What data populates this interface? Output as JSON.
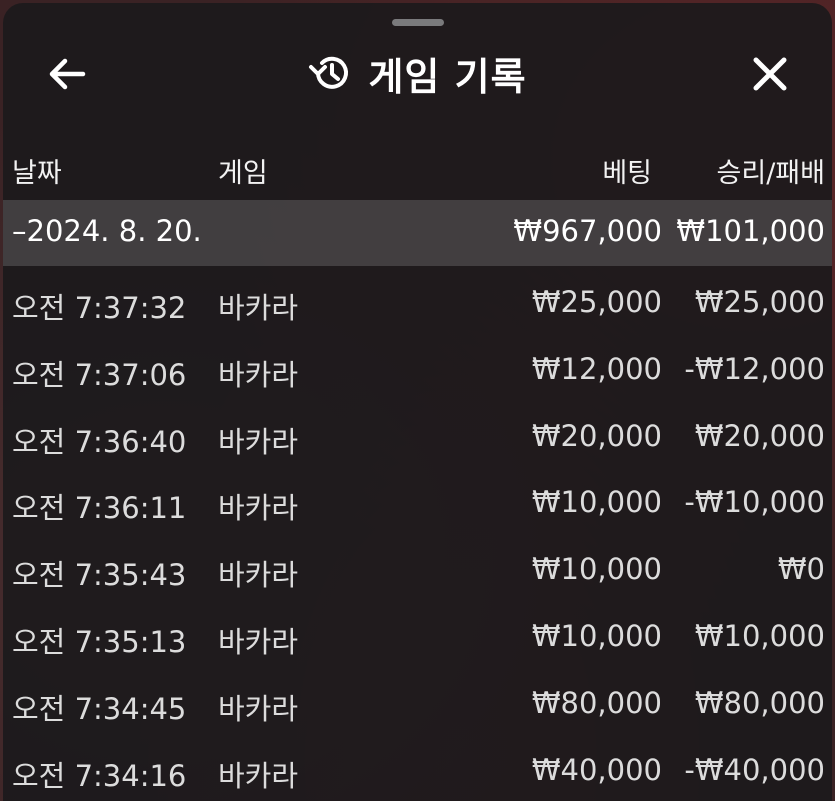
{
  "header": {
    "title": "게임 기록",
    "back_icon": "arrow-left-icon",
    "history_icon": "history-icon",
    "close_icon": "close-icon"
  },
  "columns": {
    "date": "날짜",
    "game": "게임",
    "bet": "베팅",
    "result": "승리/패배"
  },
  "day_group": {
    "date": "–2024. 8. 20.",
    "bet_total": "₩967,000",
    "result_total": "₩101,000"
  },
  "rows": [
    {
      "time": "오전 7:37:32",
      "game": "바카라",
      "bet": "₩25,000",
      "result": "₩25,000"
    },
    {
      "time": "오전 7:37:06",
      "game": "바카라",
      "bet": "₩12,000",
      "result": "-₩12,000"
    },
    {
      "time": "오전 7:36:40",
      "game": "바카라",
      "bet": "₩20,000",
      "result": "₩20,000"
    },
    {
      "time": "오전 7:36:11",
      "game": "바카라",
      "bet": "₩10,000",
      "result": "-₩10,000"
    },
    {
      "time": "오전 7:35:43",
      "game": "바카라",
      "bet": "₩10,000",
      "result": "₩0"
    },
    {
      "time": "오전 7:35:13",
      "game": "바카라",
      "bet": "₩10,000",
      "result": "₩10,000"
    },
    {
      "time": "오전 7:34:45",
      "game": "바카라",
      "bet": "₩80,000",
      "result": "₩80,000"
    },
    {
      "time": "오전 7:34:16",
      "game": "바카라",
      "bet": "₩40,000",
      "result": "-₩40,000"
    }
  ],
  "colors": {
    "sheet_bg": "#1c1a1c",
    "text": "#ffffff",
    "row_text": "#dcdcdc",
    "day_row_bg": "#5f5d5f"
  }
}
